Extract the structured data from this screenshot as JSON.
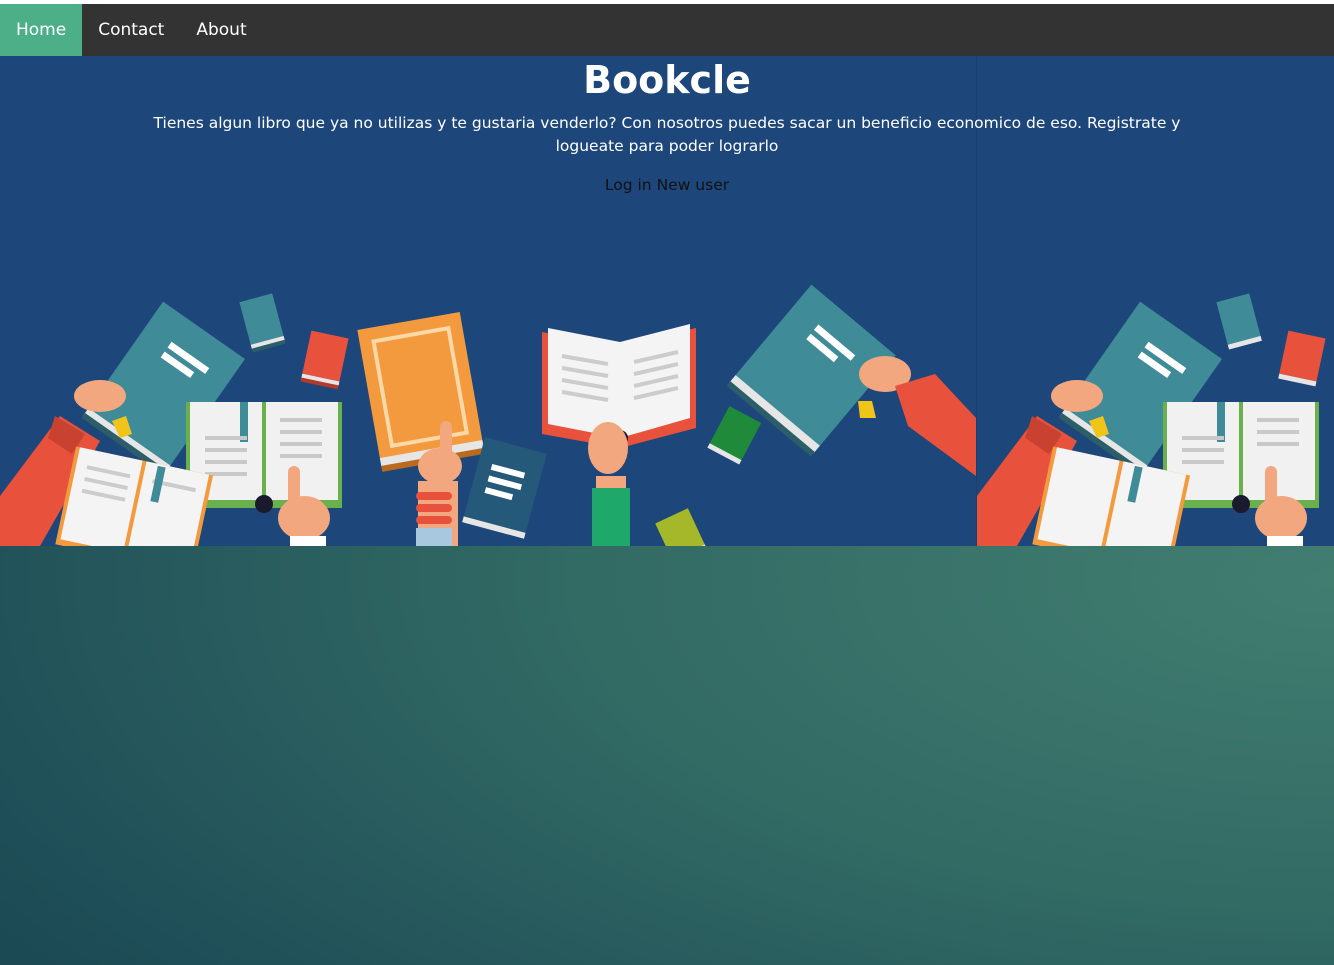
{
  "nav": {
    "items": [
      {
        "label": "Home",
        "active": true
      },
      {
        "label": "Contact",
        "active": false
      },
      {
        "label": "About",
        "active": false
      }
    ],
    "active_color": "#4caf88",
    "bar_color": "#333333"
  },
  "hero": {
    "title": "Bookcle",
    "description": "Tienes algun libro que ya no utilizas y te gustaria venderlo? Con nosotros puedes sacar un beneficio economico de eso. Registrate y logueate para poder lograrlo",
    "login_label": "Log in",
    "new_user_label": "New user",
    "background_color": "#1d467a",
    "illustration": "hands-holding-books-illustration"
  },
  "page": {
    "background_colors": [
      "#173f4b",
      "#417e70"
    ]
  }
}
